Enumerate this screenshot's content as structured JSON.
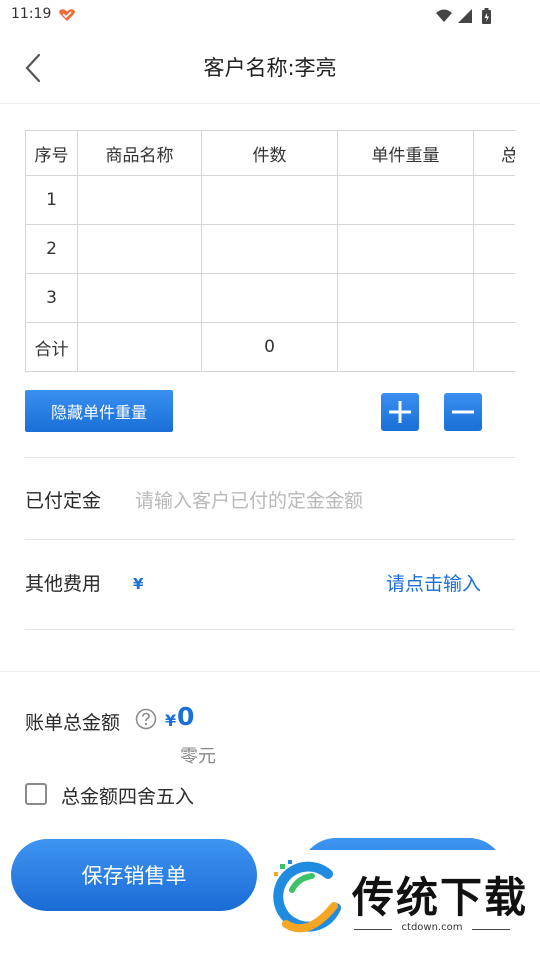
{
  "status_bar": {
    "time": "11:19"
  },
  "header": {
    "title": "客户名称:李亮"
  },
  "table": {
    "headers": [
      "序号",
      "商品名称",
      "件数",
      "单件重量",
      "总"
    ],
    "rows": [
      [
        "1",
        "",
        "",
        "",
        ""
      ],
      [
        "2",
        "",
        "",
        "",
        ""
      ],
      [
        "3",
        "",
        "",
        "",
        ""
      ],
      [
        "合计",
        "",
        "0",
        "",
        ""
      ]
    ]
  },
  "actions": {
    "hide_weight_label": "隐藏单件重量"
  },
  "deposit": {
    "label": "已付定金",
    "placeholder": "请输入客户已付的定金金额"
  },
  "other_fees": {
    "label": "其他费用",
    "currency": "¥",
    "link": "请点击输入"
  },
  "bill_total": {
    "label": "账单总金额",
    "currency": "¥",
    "value": "0",
    "in_words": "零元"
  },
  "rounding": {
    "label": "总金额四舍五入",
    "checked": false
  },
  "footer": {
    "save_label": "保存销售单"
  },
  "watermark": {
    "brand": "传统下载",
    "url": "ctdown.com"
  },
  "colors": {
    "accent": "#1a6fd8",
    "button_gradient_top": "#3a8ff0"
  }
}
